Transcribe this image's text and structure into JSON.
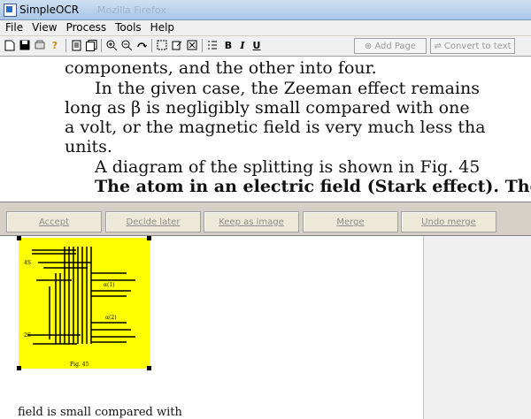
{
  "window": {
    "title": "SimpleOCR",
    "ghost_title": "Mozilla Firefox"
  },
  "menu": [
    "File",
    "View",
    "Process",
    "Tools",
    "Help"
  ],
  "toolbar": {
    "icons": [
      "new-icon",
      "save-icon",
      "scan-icon",
      "help-icon",
      "page-icon",
      "pages-icon",
      "zoom-in-icon",
      "zoom-out-icon",
      "refresh-icon",
      "select-icon",
      "edit-icon",
      "delete-icon",
      "list-icon",
      "bold-icon",
      "italic-icon",
      "underline-icon"
    ],
    "bold_label": "B",
    "italic_label": "I",
    "underline_label": "U",
    "add_page": "Add Page",
    "convert_to_text": "Convert to text"
  },
  "document": {
    "lines": [
      "components, and the other into four.",
      "In the given case, the Zeeman effect remains",
      "long as β is negligibly small compared with one",
      "a volt, or the magnetic field is very much less tha",
      "units.",
      "A diagram of the splitting is shown in Fig. 45",
      "The atom in an electric field (Stark effect). The"
    ]
  },
  "actions": {
    "accept": "Accept",
    "decide_later": "Decide later",
    "keep_as_image": "Keep as image",
    "merge": "Merge",
    "undo_merge": "Undo merge"
  },
  "image_region": {
    "caption": "Fig. 45",
    "fill_color": "#ffff00"
  },
  "snippet": "field is small compared with"
}
